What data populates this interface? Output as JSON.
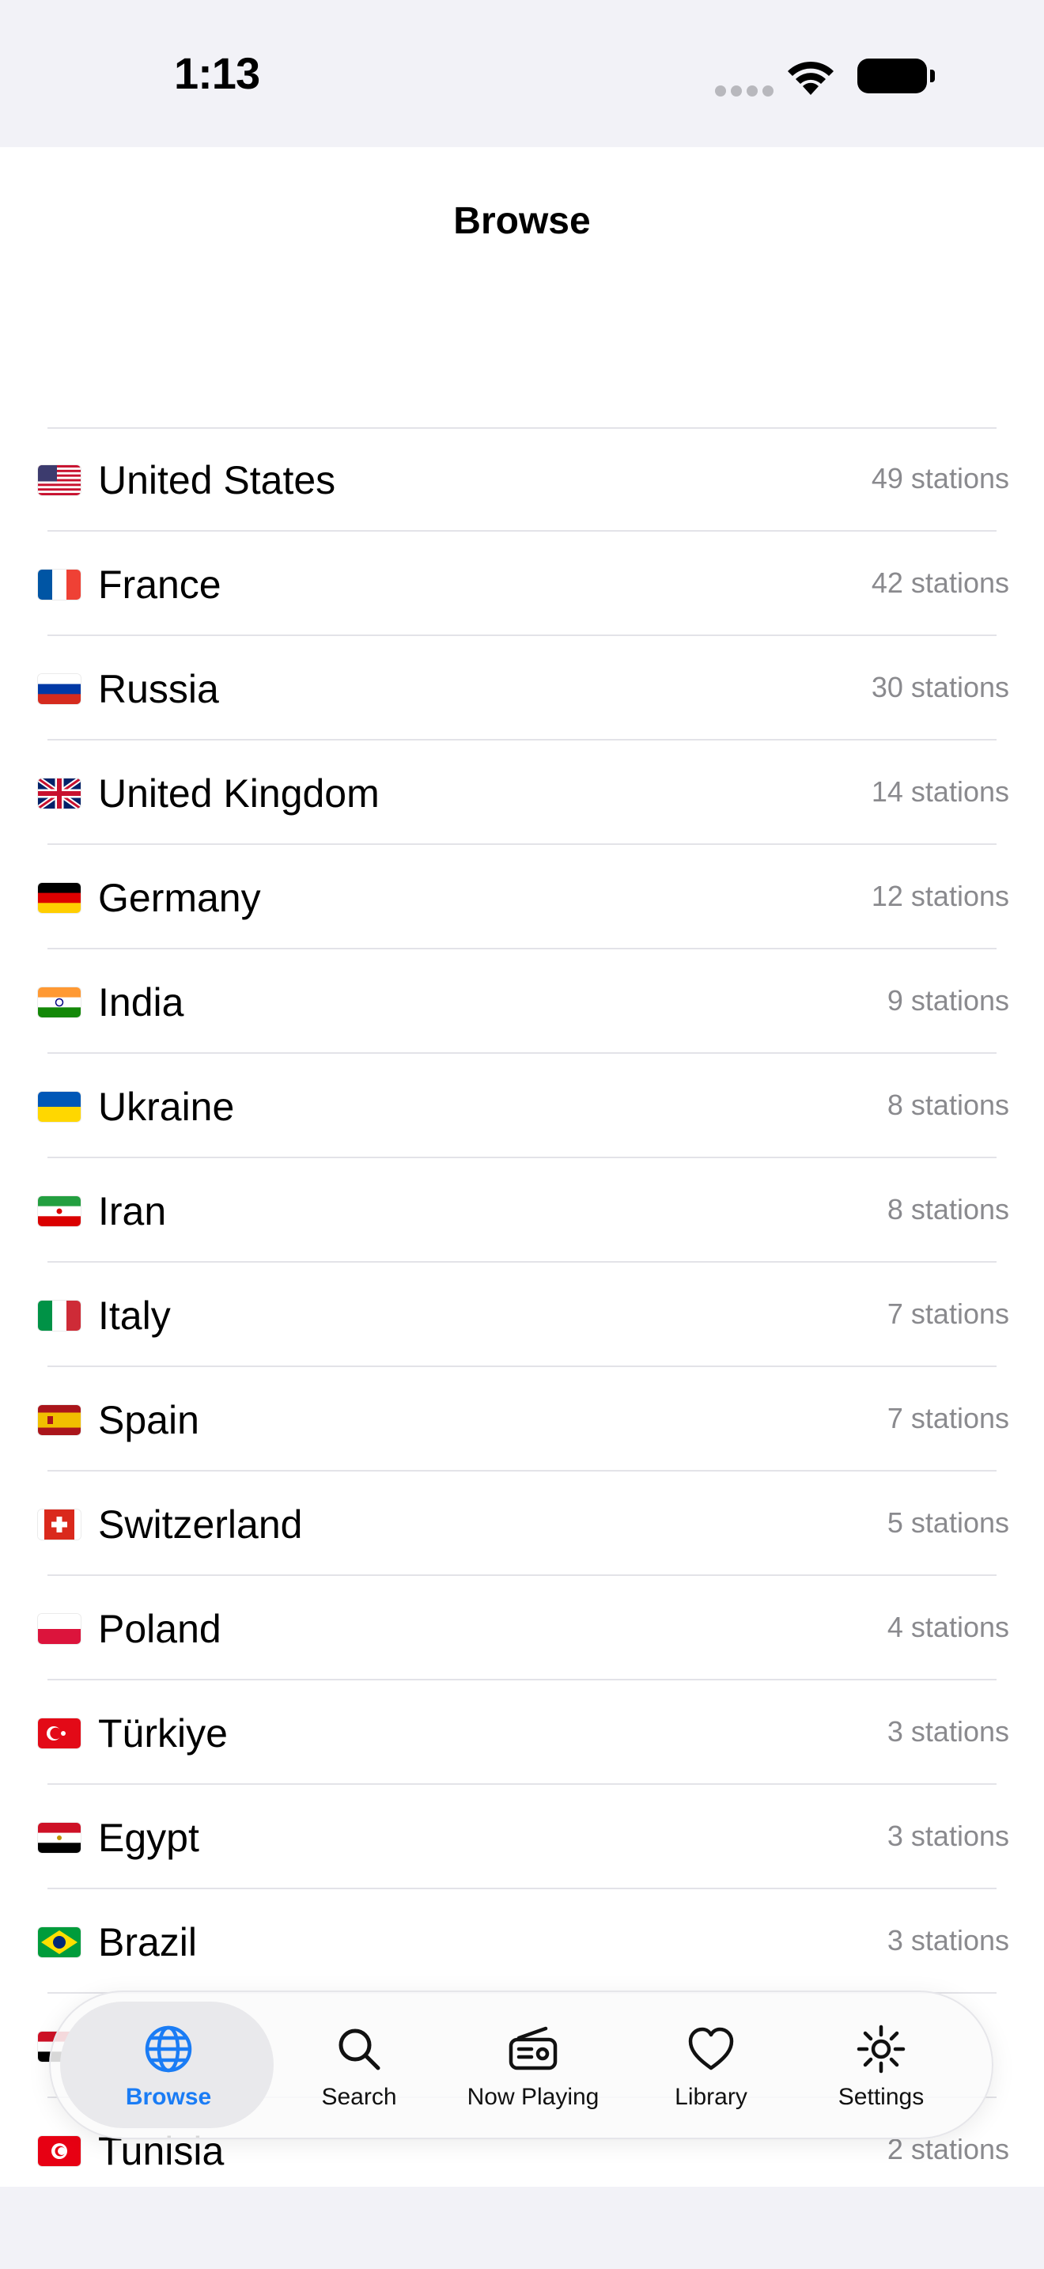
{
  "status_bar": {
    "time": "1:13"
  },
  "nav": {
    "title": "Browse"
  },
  "countries": [
    {
      "name": "United States",
      "count": "49 stations",
      "flag": "us-flag-icon"
    },
    {
      "name": "France",
      "count": "42 stations",
      "flag": "fr-flag-icon"
    },
    {
      "name": "Russia",
      "count": "30 stations",
      "flag": "ru-flag-icon"
    },
    {
      "name": "United Kingdom",
      "count": "14 stations",
      "flag": "gb-flag-icon"
    },
    {
      "name": "Germany",
      "count": "12 stations",
      "flag": "de-flag-icon"
    },
    {
      "name": "India",
      "count": "9 stations",
      "flag": "in-flag-icon"
    },
    {
      "name": "Ukraine",
      "count": "8 stations",
      "flag": "ua-flag-icon"
    },
    {
      "name": "Iran",
      "count": "8 stations",
      "flag": "ir-flag-icon"
    },
    {
      "name": "Italy",
      "count": "7 stations",
      "flag": "it-flag-icon"
    },
    {
      "name": "Spain",
      "count": "7 stations",
      "flag": "es-flag-icon"
    },
    {
      "name": "Switzerland",
      "count": "5 stations",
      "flag": "ch-flag-icon"
    },
    {
      "name": "Poland",
      "count": "4 stations",
      "flag": "pl-flag-icon"
    },
    {
      "name": "Türkiye",
      "count": "3 stations",
      "flag": "tr-flag-icon"
    },
    {
      "name": "Egypt",
      "count": "3 stations",
      "flag": "eg-flag-icon"
    },
    {
      "name": "Brazil",
      "count": "3 stations",
      "flag": "br-flag-icon"
    },
    {
      "name": "",
      "count": "",
      "flag": "ye-flag-icon"
    },
    {
      "name": "Tunisia",
      "count": "2 stations",
      "flag": "tn-flag-icon"
    }
  ],
  "tab_bar": {
    "tabs": [
      {
        "label": "Browse",
        "icon": "globe-icon",
        "active": true
      },
      {
        "label": "Search",
        "icon": "search-icon",
        "active": false
      },
      {
        "label": "Now Playing",
        "icon": "radio-icon",
        "active": false
      },
      {
        "label": "Library",
        "icon": "heart-icon",
        "active": false
      },
      {
        "label": "Settings",
        "icon": "gear-icon",
        "active": false
      }
    ]
  },
  "colors": {
    "accent": "#1a7cf5",
    "secondary_text": "#8a8a8e",
    "separator": "#e3e3e8",
    "background": "#f2f2f7"
  }
}
